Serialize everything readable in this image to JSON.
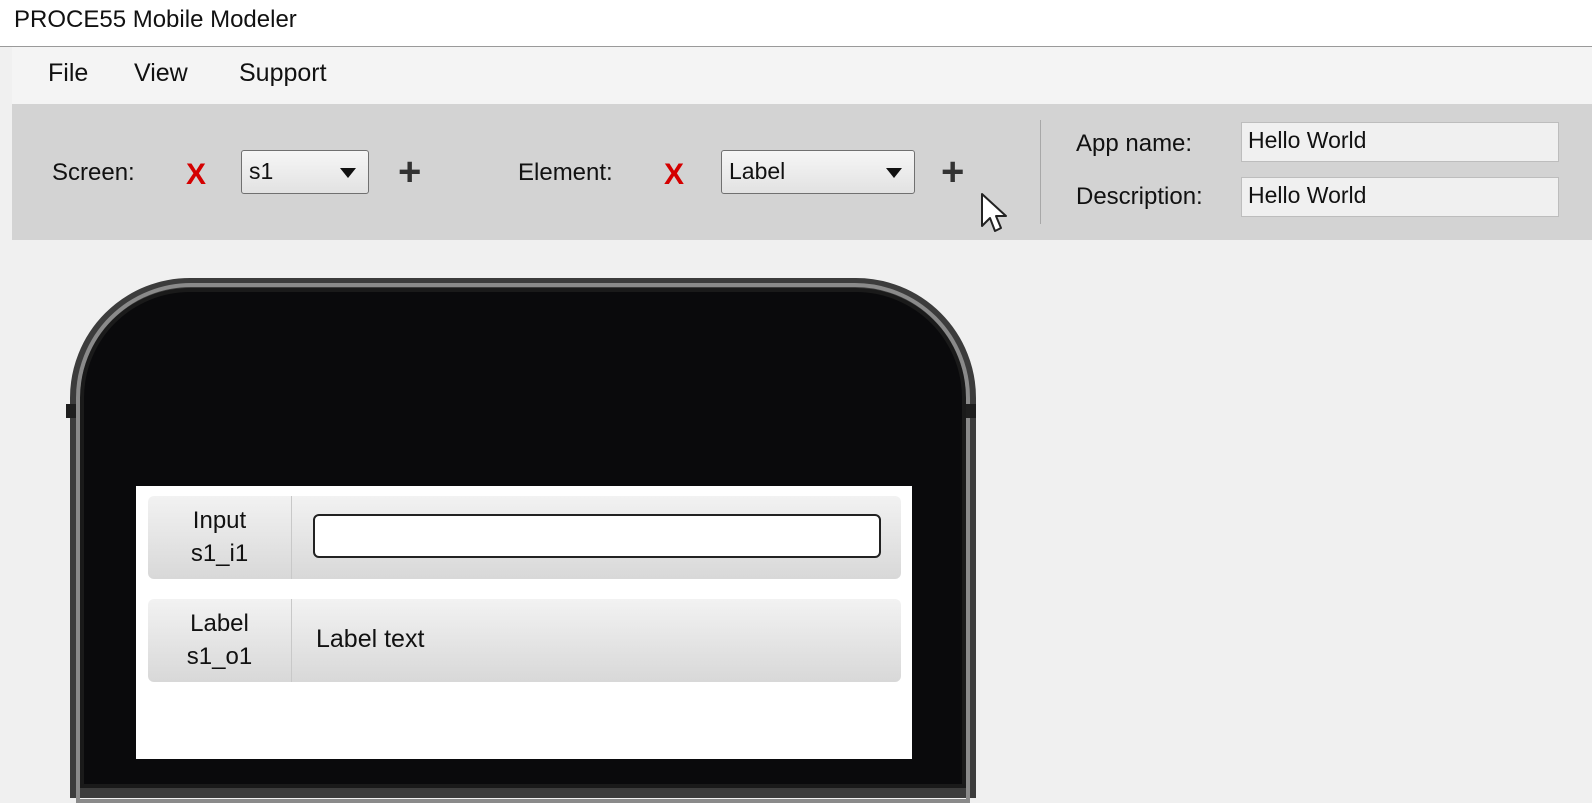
{
  "window": {
    "title": "PROCE55 Mobile Modeler"
  },
  "menu": {
    "items": [
      "File",
      "View",
      "Support"
    ]
  },
  "toolbar": {
    "screen_label": "Screen:",
    "screen_value": "s1",
    "element_label": "Element:",
    "element_value": "Label",
    "remove_glyph": "X",
    "add_glyph": "+",
    "app_name_label": "App name:",
    "app_name_value": "Hello World",
    "description_label": "Description:",
    "description_value": "Hello World"
  },
  "phone": {
    "elements": [
      {
        "type": "Input",
        "id": "s1_i1",
        "value": ""
      },
      {
        "type": "Label",
        "id": "s1_o1",
        "text": "Label text"
      }
    ]
  },
  "colors": {
    "remove": "#d40000",
    "toolbar_bg": "#d3d3d3",
    "phone_body": "#0a0a0c"
  }
}
